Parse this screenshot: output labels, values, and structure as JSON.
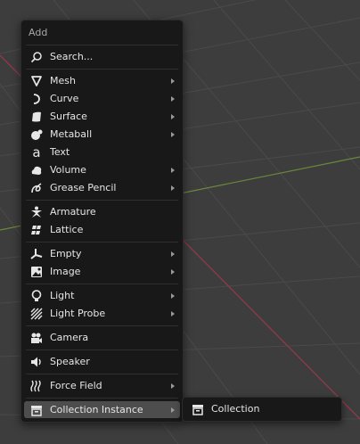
{
  "colors": {
    "viewport_bg": "#3d3d3d",
    "grid": "#4a4a4a",
    "axis_x": "#8b3a48",
    "axis_y": "#6a8a3a",
    "menu_bg": "#181818",
    "highlight": "#4d4d4d"
  },
  "menu": {
    "title": "Add",
    "items": [
      {
        "label": "Search...",
        "icon": "search-icon",
        "submenu": false
      },
      {
        "label": "Mesh",
        "icon": "mesh-icon",
        "submenu": true
      },
      {
        "label": "Curve",
        "icon": "curve-icon",
        "submenu": true
      },
      {
        "label": "Surface",
        "icon": "surface-icon",
        "submenu": true
      },
      {
        "label": "Metaball",
        "icon": "metaball-icon",
        "submenu": true
      },
      {
        "label": "Text",
        "icon": "text-icon",
        "submenu": false
      },
      {
        "label": "Volume",
        "icon": "volume-icon",
        "submenu": true
      },
      {
        "label": "Grease Pencil",
        "icon": "grease-pencil-icon",
        "submenu": true
      },
      {
        "label": "Armature",
        "icon": "armature-icon",
        "submenu": false
      },
      {
        "label": "Lattice",
        "icon": "lattice-icon",
        "submenu": false
      },
      {
        "label": "Empty",
        "icon": "empty-icon",
        "submenu": true
      },
      {
        "label": "Image",
        "icon": "image-icon",
        "submenu": true
      },
      {
        "label": "Light",
        "icon": "light-icon",
        "submenu": true
      },
      {
        "label": "Light Probe",
        "icon": "light-probe-icon",
        "submenu": true
      },
      {
        "label": "Camera",
        "icon": "camera-icon",
        "submenu": false
      },
      {
        "label": "Speaker",
        "icon": "speaker-icon",
        "submenu": false
      },
      {
        "label": "Force Field",
        "icon": "force-field-icon",
        "submenu": true
      },
      {
        "label": "Collection Instance",
        "icon": "collection-icon",
        "submenu": true,
        "active": true
      }
    ]
  },
  "submenu": {
    "items": [
      {
        "label": "Collection",
        "icon": "collection-icon"
      }
    ]
  }
}
